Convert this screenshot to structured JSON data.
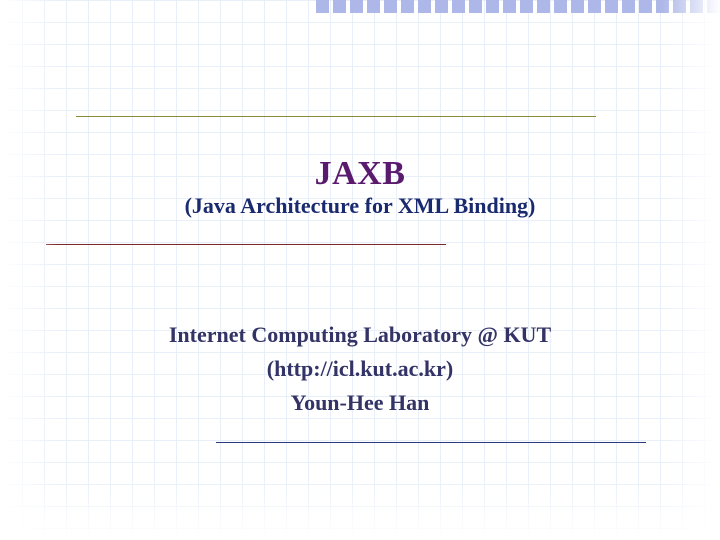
{
  "slide": {
    "title": "JAXB",
    "subtitle": "(Java Architecture for XML Binding)",
    "body": {
      "line1": "Internet Computing Laboratory @ KUT",
      "line2": "(http://icl.kut.ac.kr)",
      "line3": "Youn-Hee Han"
    }
  },
  "decor": {
    "top_square_count": 24
  },
  "colors": {
    "title": "#5a1a6e",
    "subtitle": "#1a2a6e",
    "body": "#333366",
    "grid": "#d6e3f5",
    "square": "#aeb8e8",
    "rule_olive": "#8a8a39",
    "rule_maroon": "#7a2a2a",
    "rule_navy": "#2a3a7a"
  }
}
